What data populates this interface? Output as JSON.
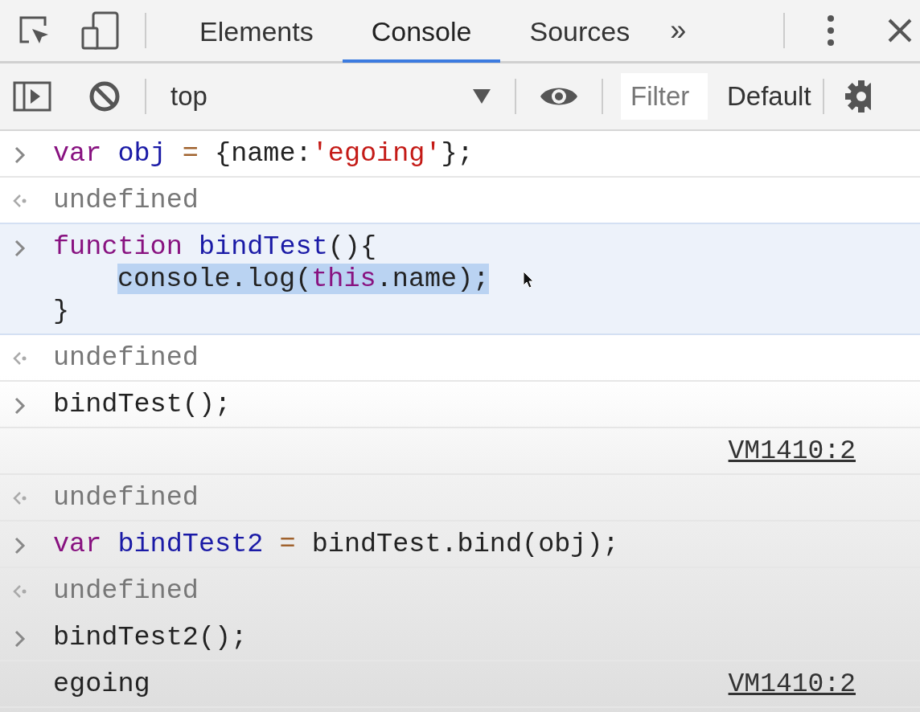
{
  "tabs": [
    {
      "label": "Elements",
      "selected": false
    },
    {
      "label": "Console",
      "selected": true
    },
    {
      "label": "Sources",
      "selected": false
    }
  ],
  "more_tabs": "»",
  "toolbar": {
    "context": "top",
    "filter": {
      "placeholder": "Filter"
    },
    "levels": "Default"
  },
  "entries": [
    {
      "kind": "input",
      "highlighted": false,
      "lines": [
        {
          "indented": false,
          "tokens": [
            {
              "text": "var",
              "kind": "keyword",
              "selected": false
            },
            {
              "text": " obj",
              "kind": "def",
              "selected": false
            },
            {
              "text": " =",
              "kind": "operator",
              "selected": false
            },
            {
              "text": " {name:",
              "kind": "plain",
              "selected": false
            },
            {
              "text": "'egoing'",
              "kind": "string",
              "selected": false
            },
            {
              "text": "};",
              "kind": "plain",
              "selected": false
            }
          ]
        }
      ]
    },
    {
      "kind": "result",
      "highlighted": false,
      "text": "undefined"
    },
    {
      "kind": "input",
      "highlighted": true,
      "cursor": true,
      "lines": [
        {
          "indented": false,
          "tokens": [
            {
              "text": "function",
              "kind": "keyword",
              "selected": false
            },
            {
              "text": " bindTest",
              "kind": "def",
              "selected": false
            },
            {
              "text": "(){",
              "kind": "plain",
              "selected": false
            }
          ]
        },
        {
          "indented": true,
          "tokens": [
            {
              "text": "console.log(",
              "kind": "plain",
              "selected": true
            },
            {
              "text": "this",
              "kind": "keyword",
              "selected": true
            },
            {
              "text": ".name);",
              "kind": "plain",
              "selected": true
            }
          ]
        },
        {
          "indented": false,
          "tokens": [
            {
              "text": "}",
              "kind": "plain",
              "selected": false
            }
          ]
        }
      ]
    },
    {
      "kind": "result",
      "highlighted": false,
      "text": "undefined"
    },
    {
      "kind": "input",
      "highlighted": false,
      "lines": [
        {
          "indented": false,
          "tokens": [
            {
              "text": "bindTest();",
              "kind": "plain",
              "selected": false
            }
          ]
        }
      ]
    },
    {
      "kind": "log",
      "highlighted": false,
      "source": "VM1410:2"
    },
    {
      "kind": "result",
      "highlighted": false,
      "text": "undefined"
    },
    {
      "kind": "input",
      "highlighted": false,
      "lines": [
        {
          "indented": false,
          "tokens": [
            {
              "text": "var",
              "kind": "keyword",
              "selected": false
            },
            {
              "text": " bindTest2",
              "kind": "def",
              "selected": false
            },
            {
              "text": " =",
              "kind": "operator",
              "selected": false
            },
            {
              "text": " bindTest.bind(obj);",
              "kind": "plain",
              "selected": false
            }
          ]
        }
      ]
    },
    {
      "kind": "result",
      "highlighted": false,
      "text": "undefined"
    },
    {
      "kind": "input",
      "highlighted": false,
      "lines": [
        {
          "indented": false,
          "tokens": [
            {
              "text": "bindTest2();",
              "kind": "plain",
              "selected": false
            }
          ]
        }
      ]
    },
    {
      "kind": "log",
      "highlighted": false,
      "text": "egoing",
      "source": "VM1410:2"
    }
  ]
}
